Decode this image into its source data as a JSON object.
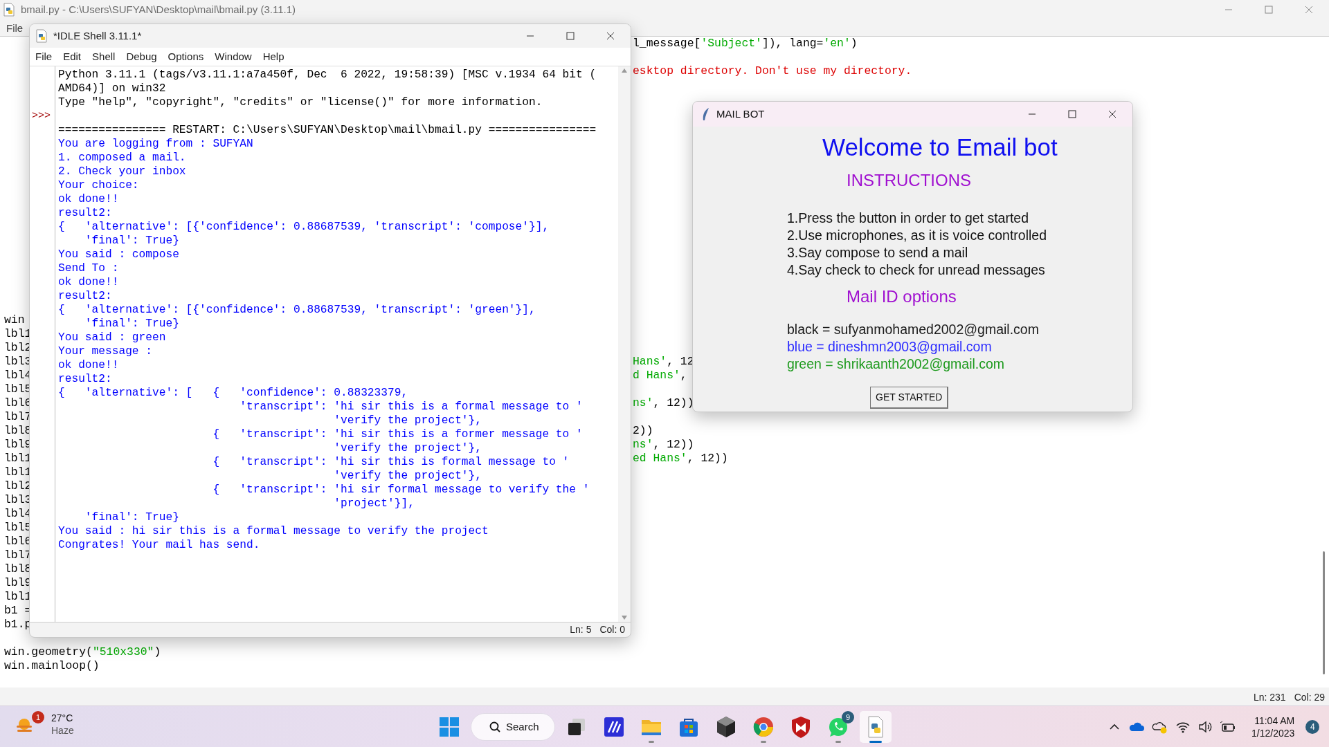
{
  "editor_window": {
    "title": "bmail.py - C:\\Users\\SUFYAN\\Desktop\\mail\\bmail.py (3.11.1)",
    "menu": [
      "File"
    ],
    "lines": [
      {
        "kind": "code",
        "right": [
          {
            "text": "l_message[",
            "kind": "plain"
          },
          {
            "text": "'Subject'",
            "kind": "string"
          },
          {
            "text": "]), lang=",
            "kind": "plain"
          },
          {
            "text": "'en'",
            "kind": "string"
          },
          {
            "text": ")",
            "kind": "plain"
          }
        ]
      },
      {
        "kind": "blank"
      },
      {
        "kind": "code",
        "right": [
          {
            "text": "esktop directory. Don't use my directory.",
            "kind": "comment"
          }
        ]
      },
      {
        "kind": "blank"
      },
      {
        "kind": "blank"
      },
      {
        "kind": "blank"
      },
      {
        "kind": "blank"
      },
      {
        "kind": "blank"
      },
      {
        "kind": "blank"
      },
      {
        "kind": "blank"
      },
      {
        "kind": "blank"
      },
      {
        "kind": "blank"
      },
      {
        "kind": "blank"
      },
      {
        "kind": "blank"
      },
      {
        "kind": "blank"
      },
      {
        "kind": "blank"
      },
      {
        "kind": "blank"
      },
      {
        "kind": "blank"
      },
      {
        "kind": "blank"
      },
      {
        "kind": "blank"
      },
      {
        "kind": "code",
        "left": [
          {
            "text": "win",
            "kind": "plain"
          }
        ]
      },
      {
        "kind": "code",
        "left": [
          {
            "text": "lbl1",
            "kind": "plain"
          }
        ]
      },
      {
        "kind": "code",
        "left": [
          {
            "text": "lbl2",
            "kind": "plain"
          }
        ]
      },
      {
        "kind": "code",
        "left": [
          {
            "text": "lbl3",
            "kind": "plain"
          }
        ],
        "right": [
          {
            "text": "Hans'",
            "kind": "string"
          },
          {
            "text": ", 12",
            "kind": "plain"
          }
        ]
      },
      {
        "kind": "code",
        "left": [
          {
            "text": "lbl4",
            "kind": "plain"
          }
        ],
        "right": [
          {
            "text": "d Hans'",
            "kind": "string"
          },
          {
            "text": ",",
            "kind": "plain"
          }
        ]
      },
      {
        "kind": "code",
        "left": [
          {
            "text": "lbl5",
            "kind": "plain"
          }
        ]
      },
      {
        "kind": "code",
        "left": [
          {
            "text": "lbl6",
            "kind": "plain"
          }
        ],
        "right": [
          {
            "text": "ns'",
            "kind": "string"
          },
          {
            "text": ", 12))",
            "kind": "plain"
          }
        ]
      },
      {
        "kind": "code",
        "left": [
          {
            "text": "lbl7",
            "kind": "plain"
          }
        ]
      },
      {
        "kind": "code",
        "left": [
          {
            "text": "lbl8",
            "kind": "plain"
          }
        ],
        "right": [
          {
            "text": "2))",
            "kind": "plain"
          }
        ]
      },
      {
        "kind": "code",
        "left": [
          {
            "text": "lbl9",
            "kind": "plain"
          }
        ],
        "right": [
          {
            "text": "ns'",
            "kind": "string"
          },
          {
            "text": ", 12))",
            "kind": "plain"
          }
        ]
      },
      {
        "kind": "code",
        "left": [
          {
            "text": "lbl1",
            "kind": "plain"
          }
        ],
        "right": [
          {
            "text": "ed Hans'",
            "kind": "string"
          },
          {
            "text": ", 12))",
            "kind": "plain"
          }
        ]
      },
      {
        "kind": "code",
        "left": [
          {
            "text": "lbl1",
            "kind": "plain"
          }
        ]
      },
      {
        "kind": "code",
        "left": [
          {
            "text": "lbl2",
            "kind": "plain"
          }
        ]
      },
      {
        "kind": "code",
        "left": [
          {
            "text": "lbl3",
            "kind": "plain"
          }
        ]
      },
      {
        "kind": "code",
        "left": [
          {
            "text": "lbl4",
            "kind": "plain"
          }
        ]
      },
      {
        "kind": "code",
        "left": [
          {
            "text": "lbl5",
            "kind": "plain"
          }
        ]
      },
      {
        "kind": "code",
        "left": [
          {
            "text": "lbl6",
            "kind": "plain"
          }
        ]
      },
      {
        "kind": "code",
        "left": [
          {
            "text": "lbl7",
            "kind": "plain"
          }
        ]
      },
      {
        "kind": "code",
        "left": [
          {
            "text": "lbl8",
            "kind": "plain"
          }
        ]
      },
      {
        "kind": "code",
        "left": [
          {
            "text": "lbl9",
            "kind": "plain"
          }
        ]
      },
      {
        "kind": "code",
        "left": [
          {
            "text": "lbl1",
            "kind": "plain"
          }
        ]
      },
      {
        "kind": "code",
        "left": [
          {
            "text": "b1 =",
            "kind": "plain"
          }
        ]
      },
      {
        "kind": "code",
        "left": [
          {
            "text": "b1.p",
            "kind": "plain"
          }
        ]
      },
      {
        "kind": "blank"
      },
      {
        "kind": "code",
        "left": [
          {
            "text": "win.geometry(",
            "kind": "plain"
          },
          {
            "text": "\"510x330\"",
            "kind": "string"
          },
          {
            "text": ")",
            "kind": "plain"
          }
        ]
      },
      {
        "kind": "code",
        "left": [
          {
            "text": "win.mainloop()",
            "kind": "plain"
          }
        ]
      }
    ],
    "status": {
      "line": "Ln: 231",
      "col": "Col: 29"
    }
  },
  "shell_window": {
    "title": "*IDLE Shell 3.11.1*",
    "menu": [
      "File",
      "Edit",
      "Shell",
      "Debug",
      "Options",
      "Window",
      "Help"
    ],
    "lines": [
      {
        "kind": "console",
        "text": "Python 3.11.1 (tags/v3.11.1:a7a450f, Dec  6 2022, 19:58:39) [MSC v.1934 64 bit ("
      },
      {
        "kind": "console",
        "text": "AMD64)] on win32"
      },
      {
        "kind": "console",
        "text": "Type \"help\", \"copyright\", \"credits\" or \"license()\" for more information."
      },
      {
        "kind": "blank",
        "prompt": ">>>"
      },
      {
        "kind": "console",
        "text": "================ RESTART: C:\\Users\\SUFYAN\\Desktop\\mail\\bmail.py ================"
      },
      {
        "kind": "stdout",
        "text": "You are logging from : SUFYAN"
      },
      {
        "kind": "stdout",
        "text": "1. composed a mail."
      },
      {
        "kind": "stdout",
        "text": "2. Check your inbox"
      },
      {
        "kind": "stdout",
        "text": "Your choice:"
      },
      {
        "kind": "stdout",
        "text": "ok done!!"
      },
      {
        "kind": "stdout",
        "text": "result2:"
      },
      {
        "kind": "stdout",
        "text": "{   'alternative': [{'confidence': 0.88687539, 'transcript': 'compose'}],"
      },
      {
        "kind": "stdout",
        "text": "    'final': True}"
      },
      {
        "kind": "stdout",
        "text": "You said : compose"
      },
      {
        "kind": "stdout",
        "text": "Send To :"
      },
      {
        "kind": "stdout",
        "text": "ok done!!"
      },
      {
        "kind": "stdout",
        "text": "result2:"
      },
      {
        "kind": "stdout",
        "text": "{   'alternative': [{'confidence': 0.88687539, 'transcript': 'green'}],"
      },
      {
        "kind": "stdout",
        "text": "    'final': True}"
      },
      {
        "kind": "stdout",
        "text": "You said : green"
      },
      {
        "kind": "stdout",
        "text": "Your message :"
      },
      {
        "kind": "stdout",
        "text": "ok done!!"
      },
      {
        "kind": "stdout",
        "text": "result2:"
      },
      {
        "kind": "stdout",
        "text": "{   'alternative': [   {   'confidence': 0.88323379,"
      },
      {
        "kind": "stdout",
        "text": "                           'transcript': 'hi sir this is a formal message to '"
      },
      {
        "kind": "stdout",
        "text": "                                         'verify the project'},"
      },
      {
        "kind": "stdout",
        "text": "                       {   'transcript': 'hi sir this is a former message to '"
      },
      {
        "kind": "stdout",
        "text": "                                         'verify the project'},"
      },
      {
        "kind": "stdout",
        "text": "                       {   'transcript': 'hi sir this is formal message to '"
      },
      {
        "kind": "stdout",
        "text": "                                         'verify the project'},"
      },
      {
        "kind": "stdout",
        "text": "                       {   'transcript': 'hi sir formal message to verify the '"
      },
      {
        "kind": "stdout",
        "text": "                                         'project'}],"
      },
      {
        "kind": "stdout",
        "text": "    'final': True}"
      },
      {
        "kind": "stdout",
        "text": "You said : hi sir this is a formal message to verify the project"
      },
      {
        "kind": "stdout",
        "text": "Congrates! Your mail has send."
      }
    ],
    "status": {
      "line": "Ln: 5",
      "col": "Col: 0"
    }
  },
  "mail_bot_window": {
    "title": "MAIL BOT",
    "heading": "Welcome to Email bot",
    "instructions_title": "INSTRUCTIONS",
    "instructions": [
      "1.Press the button in order to get started",
      "2.Use microphones, as it is voice controlled",
      "3.Say compose to send a mail",
      "4.Say check to check for unread messages"
    ],
    "options_title": "Mail ID options",
    "mail_ids": [
      {
        "text": "black = sufyanmohamed2002@gmail.com",
        "color": "#1a1a1a"
      },
      {
        "text": "blue = dineshmn2003@gmail.com",
        "color": "#2b2bff"
      },
      {
        "text": "green = shrikaanth2002@gmail.com",
        "color": "#1d9a1d"
      }
    ],
    "button": "GET STARTED"
  },
  "taskbar": {
    "weather": {
      "badge": "1",
      "temperature": "27°C",
      "condition": "Haze"
    },
    "search": {
      "label": "Search"
    },
    "apps": [
      {
        "kind": "start",
        "running": false,
        "active": false
      },
      {
        "kind": "task-view",
        "running": false,
        "active": false
      },
      {
        "kind": "editor",
        "running": false,
        "active": false
      },
      {
        "kind": "folder",
        "running": true,
        "active": false
      },
      {
        "kind": "store",
        "running": false,
        "active": false
      },
      {
        "kind": "cube",
        "running": false,
        "active": false
      },
      {
        "kind": "browser",
        "running": true,
        "active": false
      },
      {
        "kind": "shield",
        "running": false,
        "active": false
      },
      {
        "kind": "chat",
        "running": true,
        "active": false,
        "badge": "9"
      },
      {
        "kind": "python",
        "running": true,
        "active": true
      }
    ],
    "clock": {
      "time": "11:04 AM",
      "date": "1/12/2023"
    },
    "notifications": "4"
  }
}
